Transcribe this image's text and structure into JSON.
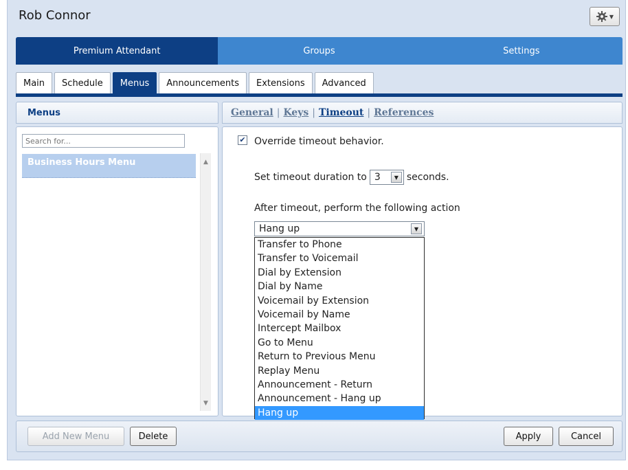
{
  "header": {
    "user_name": "Rob Connor",
    "settings_icon": "gear-icon"
  },
  "top_nav": {
    "tabs": [
      {
        "label": "Premium Attendant",
        "active": true
      },
      {
        "label": "Groups",
        "active": false
      },
      {
        "label": "Settings",
        "active": false
      }
    ]
  },
  "sub_tabs": [
    {
      "label": "Main",
      "active": false
    },
    {
      "label": "Schedule",
      "active": false
    },
    {
      "label": "Menus",
      "active": true
    },
    {
      "label": "Announcements",
      "active": false
    },
    {
      "label": "Extensions",
      "active": false
    },
    {
      "label": "Advanced",
      "active": false
    }
  ],
  "menus_panel": {
    "title": "Menus",
    "search_placeholder": "Search for...",
    "items": [
      "Business Hours Menu"
    ]
  },
  "detail_panel": {
    "tabs": [
      {
        "label": "General",
        "active": false
      },
      {
        "label": "Keys",
        "active": false
      },
      {
        "label": "Timeout",
        "active": true
      },
      {
        "label": "References",
        "active": false
      }
    ],
    "override_checked": true,
    "override_label": "Override timeout behavior.",
    "duration_prefix": "Set timeout duration to",
    "duration_value": "3",
    "duration_suffix": "seconds.",
    "action_label": "After timeout, perform the following action",
    "action_selected": "Hang up",
    "action_options": [
      "Transfer to Phone",
      "Transfer to Voicemail",
      "Dial by Extension",
      "Dial by Name",
      "Voicemail by Extension",
      "Voicemail by Name",
      "Intercept Mailbox",
      "Go to Menu",
      "Return to Previous Menu",
      "Replay Menu",
      "Announcement - Return",
      "Announcement - Hang up",
      "Hang up"
    ]
  },
  "footer": {
    "add_new_menu": "Add New Menu",
    "delete": "Delete",
    "apply": "Apply",
    "cancel": "Cancel"
  },
  "colors": {
    "nav_active": "#0d3f84",
    "nav_bg": "#3e86cf",
    "selection": "#3399ff",
    "list_selected": "#b7cfee"
  }
}
